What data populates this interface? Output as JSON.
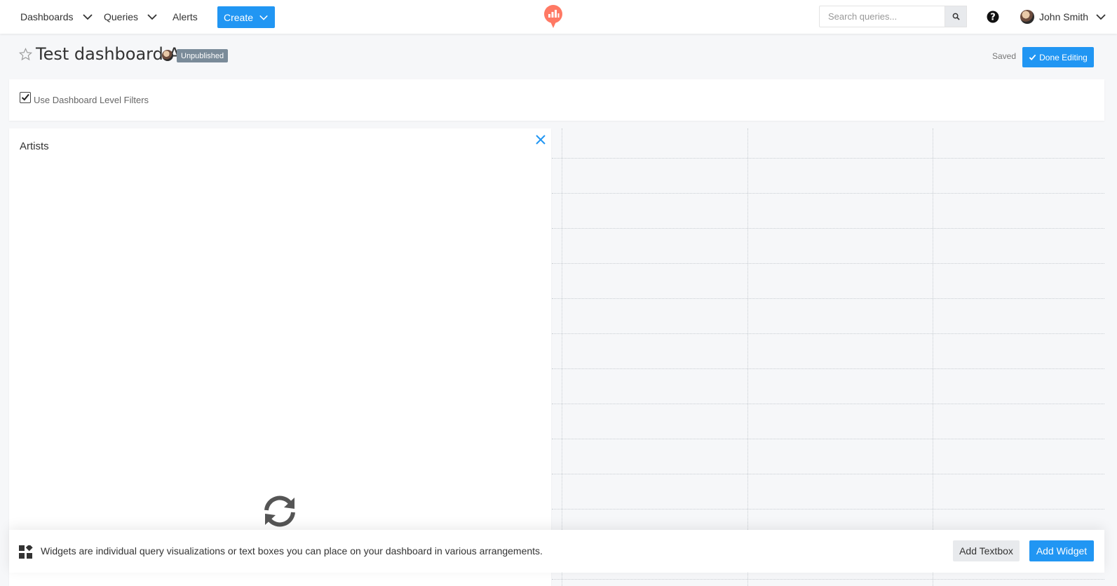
{
  "nav": {
    "dashboards": "Dashboards",
    "queries": "Queries",
    "alerts": "Alerts",
    "create": "Create",
    "search_placeholder": "Search queries...",
    "user_name": "John Smith",
    "brand_color": "#ff7964",
    "accent_color": "#2196f3"
  },
  "header": {
    "title": "Test dashboard A",
    "badge": "Unpublished",
    "saved": "Saved",
    "done_editing": "Done Editing"
  },
  "filters": {
    "label": "Use Dashboard Level Filters",
    "checked": true
  },
  "widget": {
    "title": "Artists",
    "status_icon": "refresh-icon"
  },
  "bottom_bar": {
    "text": "Widgets are individual query visualizations or text boxes you can place on your dashboard in various arrangements.",
    "add_textbox": "Add Textbox",
    "add_widget": "Add Widget"
  }
}
